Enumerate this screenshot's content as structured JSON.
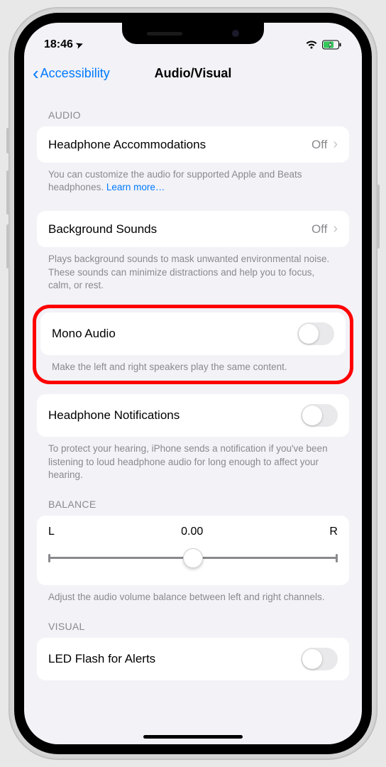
{
  "status": {
    "time": "18:46",
    "location_arrow": "➤"
  },
  "nav": {
    "back_label": "Accessibility",
    "title": "Audio/Visual"
  },
  "sections": {
    "audio": {
      "header": "AUDIO",
      "headphone_accommodations": {
        "label": "Headphone Accommodations",
        "value": "Off"
      },
      "headphone_footer": "You can customize the audio for supported Apple and Beats headphones. ",
      "headphone_learn_more": "Learn more…",
      "background_sounds": {
        "label": "Background Sounds",
        "value": "Off"
      },
      "background_footer": "Plays background sounds to mask unwanted environmental noise. These sounds can minimize distractions and help you to focus, calm, or rest.",
      "mono_audio": {
        "label": "Mono Audio"
      },
      "mono_footer": "Make the left and right speakers play the same content.",
      "headphone_notifications": {
        "label": "Headphone Notifications"
      },
      "hn_footer": "To protect your hearing, iPhone sends a notification if you've been listening to loud headphone audio for long enough to affect your hearing."
    },
    "balance": {
      "header": "BALANCE",
      "left": "L",
      "value": "0.00",
      "right": "R",
      "footer": "Adjust the audio volume balance between left and right channels."
    },
    "visual": {
      "header": "VISUAL",
      "led_flash": {
        "label": "LED Flash for Alerts"
      }
    }
  }
}
